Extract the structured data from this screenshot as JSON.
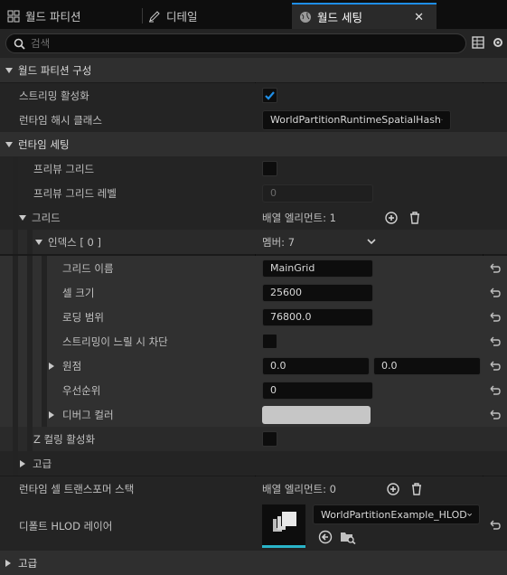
{
  "tabs": [
    {
      "label": "월드 파티션",
      "icon": "world-partition-icon"
    },
    {
      "label": "디테일",
      "icon": "pencil-icon"
    },
    {
      "label": "월드 세팅",
      "icon": "globe-icon",
      "active": true
    }
  ],
  "search": {
    "placeholder": "검색"
  },
  "sections": {
    "world_partition_setup": "월드 파티션 구성",
    "streaming_enabled": "스트리밍 활성화",
    "runtime_hash_class": "런타임 해시 클래스",
    "runtime_hash_class_value": "WorldPartitionRuntimeSpatialHash",
    "runtime_settings": "런타임 세팅",
    "preview_grids": "프리뷰 그리드",
    "preview_grid_level": "프리뷰 그리드 레벨",
    "preview_grid_level_value": "0",
    "grids": "그리드",
    "grids_count": "배열 엘리먼트: 1",
    "index": "인덱스 [ 0 ]",
    "members": "멤버: 7",
    "grid_name": "그리드 이름",
    "grid_name_value": "MainGrid",
    "cell_size": "셀 크기",
    "cell_size_value": "25600",
    "loading_range": "로딩 범위",
    "loading_range_value": "76800.0",
    "block_on_slow_streaming": "스트리밍이 느릴 시 차단",
    "origin": "원점",
    "origin_x": "0.0",
    "origin_y": "0.0",
    "priority": "우선순위",
    "priority_value": "0",
    "debug_color": "디버그 컬러",
    "debug_color_value": "#c6c6c6",
    "z_culling": "Z 컬링 활성화",
    "advanced_inner": "고급",
    "runtime_cell_transformer_stack": "런타임 셀 트랜스포머 스택",
    "transformer_count": "배열 엘리먼트: 0",
    "default_hlod_layer": "디폴트 HLOD 레이어",
    "default_hlod_layer_value": "WorldPartitionExample_HLOD",
    "advanced": "고급"
  },
  "colors": {
    "accent": "#1f8ee6",
    "checked": "#1f8ee6"
  }
}
